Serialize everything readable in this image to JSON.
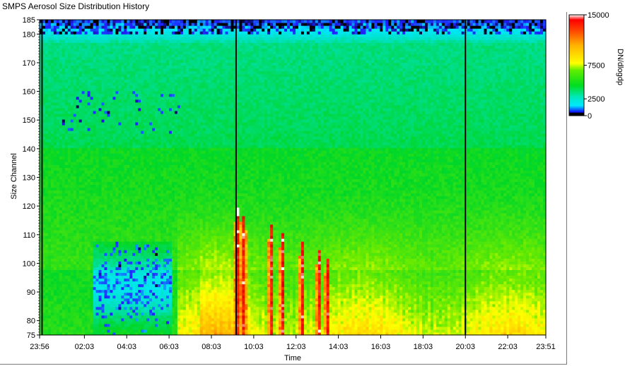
{
  "window": {
    "title": "SMPS Aerosol Size Distribution History"
  },
  "chart_data": {
    "type": "heatmap",
    "title": "",
    "xlabel": "Time",
    "ylabel": "Size Channel",
    "x_ticks": [
      "23:56",
      "02:03",
      "04:03",
      "06:03",
      "08:03",
      "10:03",
      "12:03",
      "14:03",
      "16:03",
      "18:03",
      "20:03",
      "22:03",
      "23:51"
    ],
    "y_ticks": [
      75,
      80,
      90,
      100,
      110,
      120,
      130,
      140,
      150,
      160,
      170,
      180,
      185
    ],
    "ylim": [
      75,
      185
    ],
    "colorbar": {
      "label": "DN/dlogdp",
      "ticks": [
        0,
        2500,
        7500,
        15000
      ],
      "tick_labels": [
        "0",
        "2500",
        "7500",
        "15000"
      ],
      "range": [
        0,
        15000
      ]
    },
    "vertical_markers": [
      "00:03",
      "09:13",
      "20:03"
    ],
    "description_levels": {
      "low_channels_daytime": "high concentration (green to yellow/orange) with short red/white bursts between 09:13 and 13:30",
      "mid_channels": "moderate (green)",
      "high_channels": "low (cyan)",
      "top_channels_181_185": "near zero (blue/purple/black)",
      "early_morning_low_channels": "low concentration patches (blue/purple) around 02:30 to 06:10"
    },
    "colors": {
      "zero": "#000000",
      "low": "#2020ff",
      "lowmid": "#00e8ff",
      "mid": "#00d200",
      "high": "#ffff00",
      "veryhigh": "#ff2000",
      "max": "#ffffff"
    }
  }
}
